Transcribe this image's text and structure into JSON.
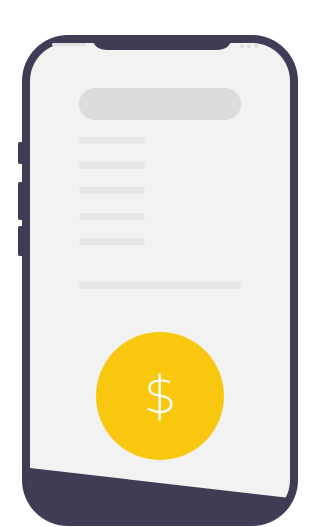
{
  "illustration": {
    "subject": "smartphone-payment",
    "colors": {
      "frame": "#3f3d56",
      "screen": "#f2f2f2",
      "placeholder_block": "#dcdcdc",
      "placeholder_line": "#e6e6e6",
      "accent": "#f9c80e",
      "glyph": "#ffffff"
    },
    "coin": {
      "icon": "dollar-sign-icon",
      "symbol": "$"
    },
    "list_placeholder_count": 5
  }
}
